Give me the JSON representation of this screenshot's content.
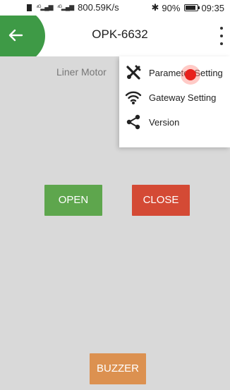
{
  "status_bar": {
    "network": "800.59K/s",
    "battery": "90%",
    "time": "09:35"
  },
  "app_bar": {
    "title": "OPK-6632"
  },
  "main": {
    "section_label": "Liner Motor",
    "open_label": "OPEN",
    "close_label": "CLOSE",
    "buzzer_label": "BUZZER"
  },
  "menu": {
    "items": [
      {
        "label": "Parameter Setting",
        "icon": "tools-icon"
      },
      {
        "label": "Gateway Setting",
        "icon": "wifi-icon"
      },
      {
        "label": "Version",
        "icon": "share-icon"
      }
    ]
  },
  "colors": {
    "accent": "#3e9a46",
    "open": "#5ea64d",
    "close": "#d44a35",
    "buzzer": "#dc9150",
    "background": "#d9d9d9"
  }
}
